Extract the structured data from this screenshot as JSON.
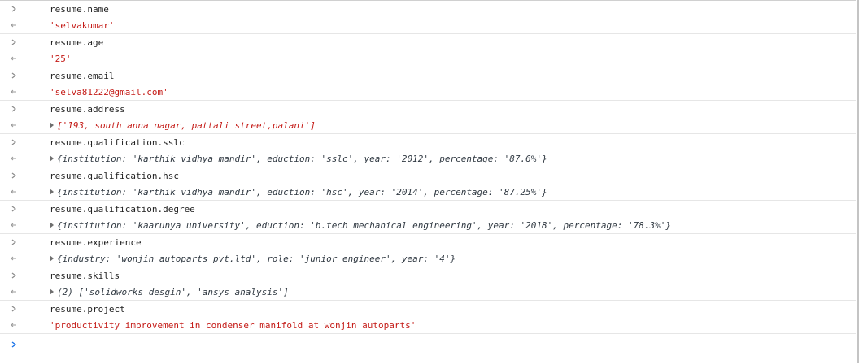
{
  "entries": [
    {
      "input": "resume.name",
      "output_text": "'selvakumar'"
    },
    {
      "input": "resume.age",
      "output_text": "'25'"
    },
    {
      "input": "resume.email",
      "output_text": "'selva81222@gmail.com'"
    },
    {
      "input": "resume.address",
      "output_text": "['193, south anna nagar, pattali street,palani']"
    },
    {
      "input": "resume.qualification.sslc",
      "output_text": "{institution: 'karthik vidhya mandir', eduction: 'sslc', year: '2012', percentage: '87.6%'}"
    },
    {
      "input": "resume.qualification.hsc",
      "output_text": "{institution: 'karthik vidhya mandir', eduction: 'hsc', year: '2014', percentage: '87.25%'}"
    },
    {
      "input": "resume.qualification.degree",
      "output_text": "{institution: 'kaarunya university', eduction: 'b.tech mechanical engineering', year: '2018', percentage: '78.3%'}"
    },
    {
      "input": "resume.experience",
      "output_text": "{industry: 'wonjin autoparts pvt.ltd', role: 'junior engineer', year: '4'}"
    },
    {
      "input": "resume.skills",
      "output_text": "(2) ['solidworks desgin', 'ansys analysis']"
    },
    {
      "input": "resume.project",
      "output_text": "'productivity improvement in condenser manifold at wonjin autoparts'"
    }
  ],
  "icons": {
    "input_prompt": "chevron-right-icon",
    "output_prompt": "return-arrow-icon",
    "expand": "expand-triangle-icon"
  },
  "colors": {
    "string": "#c41a16",
    "prompt_active": "#1a73e8",
    "prompt": "#8a8a8a"
  }
}
